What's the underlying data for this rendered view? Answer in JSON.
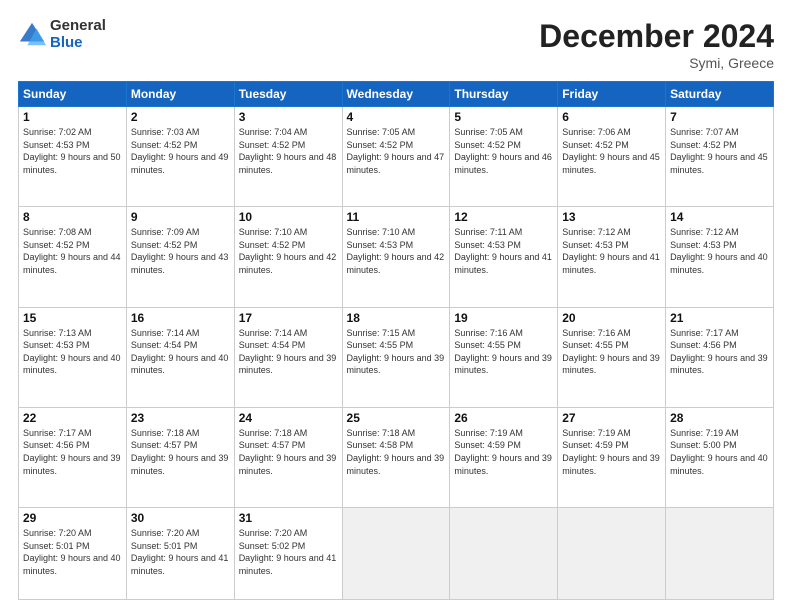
{
  "logo": {
    "general": "General",
    "blue": "Blue"
  },
  "header": {
    "month": "December 2024",
    "location": "Symi, Greece"
  },
  "days_of_week": [
    "Sunday",
    "Monday",
    "Tuesday",
    "Wednesday",
    "Thursday",
    "Friday",
    "Saturday"
  ],
  "weeks": [
    [
      {
        "day": "1",
        "sunrise": "7:02 AM",
        "sunset": "4:53 PM",
        "daylight": "9 hours and 50 minutes."
      },
      {
        "day": "2",
        "sunrise": "7:03 AM",
        "sunset": "4:52 PM",
        "daylight": "9 hours and 49 minutes."
      },
      {
        "day": "3",
        "sunrise": "7:04 AM",
        "sunset": "4:52 PM",
        "daylight": "9 hours and 48 minutes."
      },
      {
        "day": "4",
        "sunrise": "7:05 AM",
        "sunset": "4:52 PM",
        "daylight": "9 hours and 47 minutes."
      },
      {
        "day": "5",
        "sunrise": "7:05 AM",
        "sunset": "4:52 PM",
        "daylight": "9 hours and 46 minutes."
      },
      {
        "day": "6",
        "sunrise": "7:06 AM",
        "sunset": "4:52 PM",
        "daylight": "9 hours and 45 minutes."
      },
      {
        "day": "7",
        "sunrise": "7:07 AM",
        "sunset": "4:52 PM",
        "daylight": "9 hours and 45 minutes."
      }
    ],
    [
      {
        "day": "8",
        "sunrise": "7:08 AM",
        "sunset": "4:52 PM",
        "daylight": "9 hours and 44 minutes."
      },
      {
        "day": "9",
        "sunrise": "7:09 AM",
        "sunset": "4:52 PM",
        "daylight": "9 hours and 43 minutes."
      },
      {
        "day": "10",
        "sunrise": "7:10 AM",
        "sunset": "4:52 PM",
        "daylight": "9 hours and 42 minutes."
      },
      {
        "day": "11",
        "sunrise": "7:10 AM",
        "sunset": "4:53 PM",
        "daylight": "9 hours and 42 minutes."
      },
      {
        "day": "12",
        "sunrise": "7:11 AM",
        "sunset": "4:53 PM",
        "daylight": "9 hours and 41 minutes."
      },
      {
        "day": "13",
        "sunrise": "7:12 AM",
        "sunset": "4:53 PM",
        "daylight": "9 hours and 41 minutes."
      },
      {
        "day": "14",
        "sunrise": "7:12 AM",
        "sunset": "4:53 PM",
        "daylight": "9 hours and 40 minutes."
      }
    ],
    [
      {
        "day": "15",
        "sunrise": "7:13 AM",
        "sunset": "4:53 PM",
        "daylight": "9 hours and 40 minutes."
      },
      {
        "day": "16",
        "sunrise": "7:14 AM",
        "sunset": "4:54 PM",
        "daylight": "9 hours and 40 minutes."
      },
      {
        "day": "17",
        "sunrise": "7:14 AM",
        "sunset": "4:54 PM",
        "daylight": "9 hours and 39 minutes."
      },
      {
        "day": "18",
        "sunrise": "7:15 AM",
        "sunset": "4:55 PM",
        "daylight": "9 hours and 39 minutes."
      },
      {
        "day": "19",
        "sunrise": "7:16 AM",
        "sunset": "4:55 PM",
        "daylight": "9 hours and 39 minutes."
      },
      {
        "day": "20",
        "sunrise": "7:16 AM",
        "sunset": "4:55 PM",
        "daylight": "9 hours and 39 minutes."
      },
      {
        "day": "21",
        "sunrise": "7:17 AM",
        "sunset": "4:56 PM",
        "daylight": "9 hours and 39 minutes."
      }
    ],
    [
      {
        "day": "22",
        "sunrise": "7:17 AM",
        "sunset": "4:56 PM",
        "daylight": "9 hours and 39 minutes."
      },
      {
        "day": "23",
        "sunrise": "7:18 AM",
        "sunset": "4:57 PM",
        "daylight": "9 hours and 39 minutes."
      },
      {
        "day": "24",
        "sunrise": "7:18 AM",
        "sunset": "4:57 PM",
        "daylight": "9 hours and 39 minutes."
      },
      {
        "day": "25",
        "sunrise": "7:18 AM",
        "sunset": "4:58 PM",
        "daylight": "9 hours and 39 minutes."
      },
      {
        "day": "26",
        "sunrise": "7:19 AM",
        "sunset": "4:59 PM",
        "daylight": "9 hours and 39 minutes."
      },
      {
        "day": "27",
        "sunrise": "7:19 AM",
        "sunset": "4:59 PM",
        "daylight": "9 hours and 39 minutes."
      },
      {
        "day": "28",
        "sunrise": "7:19 AM",
        "sunset": "5:00 PM",
        "daylight": "9 hours and 40 minutes."
      }
    ],
    [
      {
        "day": "29",
        "sunrise": "7:20 AM",
        "sunset": "5:01 PM",
        "daylight": "9 hours and 40 minutes."
      },
      {
        "day": "30",
        "sunrise": "7:20 AM",
        "sunset": "5:01 PM",
        "daylight": "9 hours and 41 minutes."
      },
      {
        "day": "31",
        "sunrise": "7:20 AM",
        "sunset": "5:02 PM",
        "daylight": "9 hours and 41 minutes."
      },
      null,
      null,
      null,
      null
    ]
  ]
}
